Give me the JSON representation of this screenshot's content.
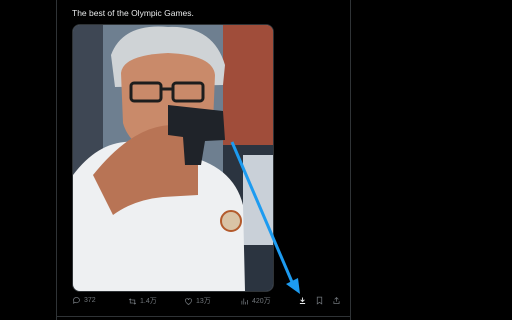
{
  "post": {
    "text": "The best of the Olympic Games."
  },
  "actions": {
    "replies": "372",
    "reposts": "1.4万",
    "likes": "13万",
    "views": "420万"
  },
  "colors": {
    "background": "#000000",
    "text": "#e7e9ea",
    "muted": "#71767b",
    "annotation_arrow": "#1d9bf0"
  },
  "icons": [
    "reply-icon",
    "repost-icon",
    "like-icon",
    "views-icon",
    "download-icon",
    "bookmark-icon",
    "share-icon"
  ]
}
